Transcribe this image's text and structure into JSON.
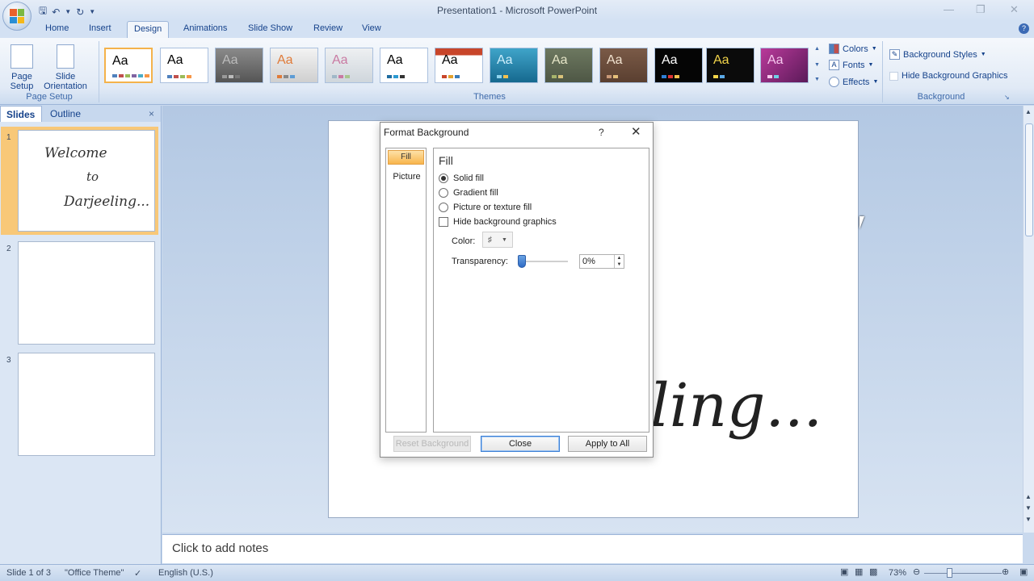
{
  "window": {
    "title": "Presentation1 - Microsoft PowerPoint"
  },
  "ribbon": {
    "tabs": [
      "Home",
      "Insert",
      "Design",
      "Animations",
      "Slide Show",
      "Review",
      "View"
    ],
    "active_tab": "Design",
    "page_setup": {
      "page_setup_label": "Page Setup",
      "slide_orientation_label": "Slide Orientation",
      "group_label": "Page Setup"
    },
    "themes": {
      "sample_text": "Aa",
      "group_label": "Themes",
      "colors_label": "Colors",
      "fonts_label": "Fonts",
      "effects_label": "Effects"
    },
    "background": {
      "background_styles_label": "Background Styles",
      "hide_graphics_label": "Hide Background Graphics",
      "group_label": "Background"
    }
  },
  "slides_pane": {
    "tab_slides": "Slides",
    "tab_outline": "Outline",
    "slides": [
      {
        "number": "1",
        "lines": [
          "Welcome",
          "to",
          "Darjeeling..."
        ]
      },
      {
        "number": "2"
      },
      {
        "number": "3"
      }
    ]
  },
  "slide": {
    "visible_text": "eeling..."
  },
  "notes": {
    "placeholder": "Click to add notes"
  },
  "status_bar": {
    "slide_info": "Slide 1 of 3",
    "theme_name": "\"Office Theme\"",
    "language": "English (U.S.)",
    "zoom": "73%"
  },
  "dialog": {
    "title": "Format Background",
    "help": "?",
    "nav": {
      "fill": "Fill",
      "picture": "Picture"
    },
    "panel_title": "Fill",
    "options": {
      "solid_fill": "Solid fill",
      "gradient_fill": "Gradient fill",
      "picture_texture_fill": "Picture or texture fill",
      "hide_background_graphics": "Hide background graphics"
    },
    "color_label": "Color:",
    "transparency_label": "Transparency:",
    "transparency_value": "0%",
    "buttons": {
      "reset": "Reset Background",
      "close": "Close",
      "apply_all": "Apply to All"
    }
  }
}
